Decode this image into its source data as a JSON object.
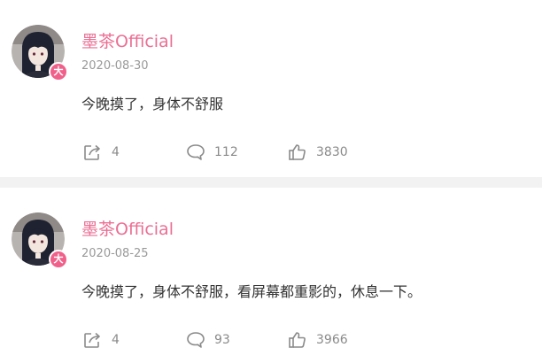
{
  "posts": [
    {
      "username": "墨茶Official",
      "date": "2020-08-30",
      "content": "今晚摸了，身体不舒服",
      "badge": "大",
      "share_count": "4",
      "comment_count": "112",
      "like_count": "3830"
    },
    {
      "username": "墨茶Official",
      "date": "2020-08-25",
      "content": "今晚摸了，身体不舒服，看屏幕都重影的，休息一下。",
      "badge": "大",
      "share_count": "4",
      "comment_count": "93",
      "like_count": "3966"
    }
  ],
  "icons": {
    "share": "share-icon",
    "comment": "comment-icon",
    "like": "thumbs-up-icon",
    "badge": "verified-badge-icon"
  },
  "colors": {
    "username": "#eb6f95",
    "badge": "#f0608a",
    "date": "#999999",
    "content": "#333333",
    "action": "#8a8a8a",
    "divider": "#f2f2f2"
  }
}
